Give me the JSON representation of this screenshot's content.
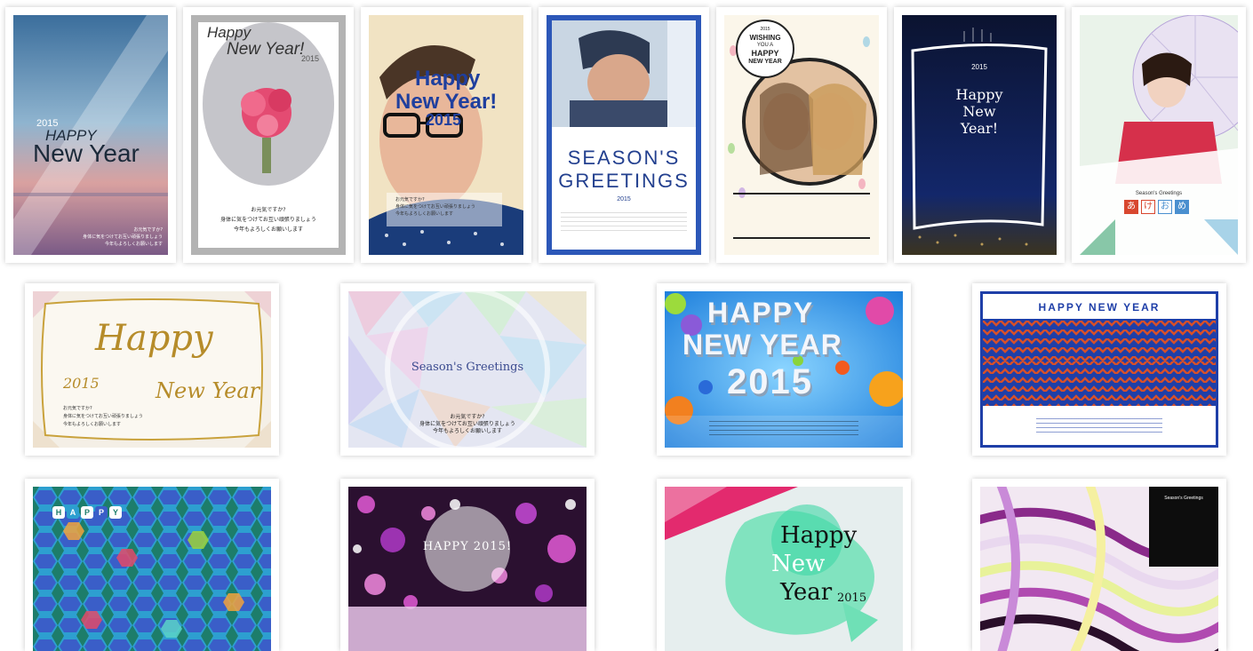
{
  "gallery": {
    "cards": [
      {
        "id": "sky",
        "year": "2015",
        "line1": "HAPPY",
        "line2": "New Year",
        "msg": [
          "お元気ですか?",
          "身体に気をつけてお互い頑張りましょう",
          "今年もよろしくお願いします"
        ]
      },
      {
        "id": "bouquet",
        "line1": "Happy",
        "line2": "New Year!",
        "year": "2015",
        "msg": [
          "お元気ですか?",
          "身体に気をつけてお互い頑張りましょう",
          "今年もよろしくお願いします"
        ]
      },
      {
        "id": "boy",
        "line1": "Happy",
        "line2": "New Year!",
        "year": "2015",
        "msg": [
          "お元気ですか?",
          "身体に気をつけてお互い頑張りましょう",
          "今年もよろしくお願いします"
        ]
      },
      {
        "id": "seasons",
        "line1": "SEASON'S",
        "line2": "GREETINGS",
        "year": "2015"
      },
      {
        "id": "girls",
        "badge": [
          "2015",
          "WISHING",
          "YOU A",
          "HAPPY",
          "NEW YEAR"
        ]
      },
      {
        "id": "night",
        "year": "2015",
        "line1": "Happy",
        "line2": "New",
        "line3": "Year!"
      },
      {
        "id": "kimono",
        "small": "Season's Greetings",
        "kana": [
          "あ",
          "け",
          "お",
          "め"
        ]
      },
      {
        "id": "gold",
        "line1": "Happy",
        "line2": "New Year",
        "year": "2015",
        "msg": [
          "お元気ですか?",
          "身体に気をつけてお互い頑張りましょう",
          "今年もよろしくお願いします"
        ]
      },
      {
        "id": "prism",
        "line1": "Season's Greetings",
        "msg": [
          "お元気ですか?",
          "身体に気をつけてお互い頑張りましょう",
          "今年もよろしくお願いします"
        ]
      },
      {
        "id": "3d",
        "line1": "HAPPY",
        "line2": "NEW YEAR",
        "line3": "2015"
      },
      {
        "id": "chevron",
        "line1": "HAPPY NEW YEAR"
      },
      {
        "id": "hex",
        "letters": [
          "H",
          "A",
          "P",
          "P",
          "Y"
        ]
      },
      {
        "id": "bokeh",
        "line1": "HAPPY 2015!"
      },
      {
        "id": "mint",
        "line1": "Happy",
        "line2": "New",
        "line3": "Year",
        "year": "2015"
      },
      {
        "id": "ribbons",
        "line1": "Season's Greetings"
      }
    ]
  },
  "colors": {
    "navy": "#1d3c8c",
    "gold": "#b68c2a",
    "royal": "#1f3fa8",
    "orange": "#d6502a"
  }
}
